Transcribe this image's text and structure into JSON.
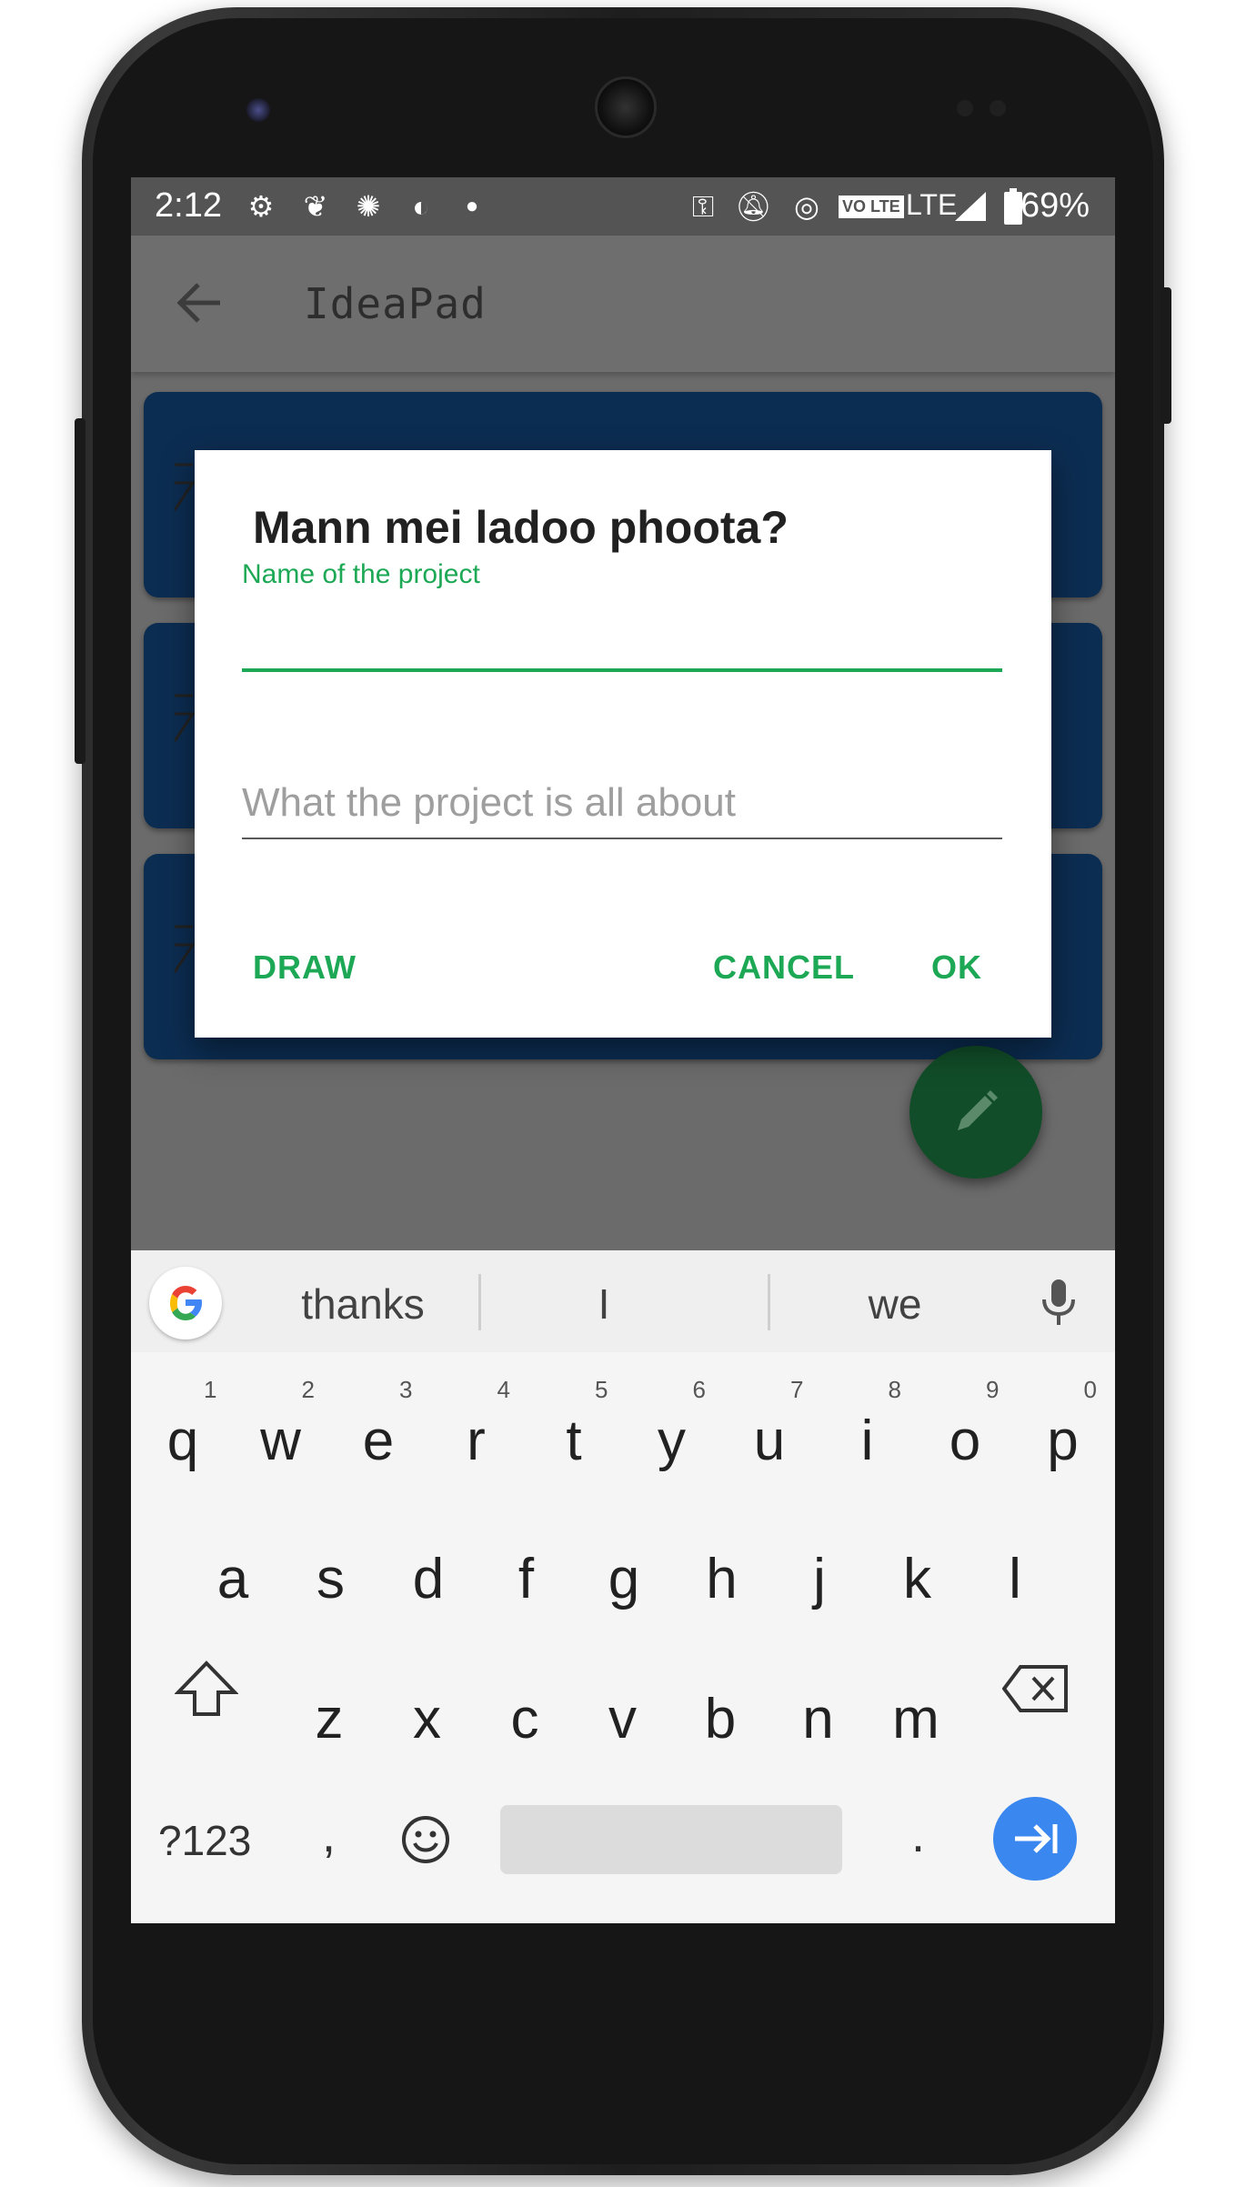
{
  "status_bar": {
    "time": "2:12",
    "network": "LTE",
    "volte": "VO LTE",
    "battery": "69%"
  },
  "app_bar": {
    "title": "IdeaPad",
    "back_icon": "arrow-back-icon"
  },
  "dialog": {
    "title": "Mann mei ladoo phoota?",
    "name_label": "Name of the project",
    "name_value": "",
    "description_placeholder": "What the project is all about",
    "draw_label": "DRAW",
    "cancel_label": "CANCEL",
    "ok_label": "OK"
  },
  "fab": {
    "icon": "pencil-icon"
  },
  "keyboard": {
    "suggestions": [
      "thanks",
      "I",
      "we"
    ],
    "row1": [
      "q",
      "w",
      "e",
      "r",
      "t",
      "y",
      "u",
      "i",
      "o",
      "p"
    ],
    "row1_hints": [
      "1",
      "2",
      "3",
      "4",
      "5",
      "6",
      "7",
      "8",
      "9",
      "0"
    ],
    "row2": [
      "a",
      "s",
      "d",
      "f",
      "g",
      "h",
      "j",
      "k",
      "l"
    ],
    "row3": [
      "z",
      "x",
      "c",
      "v",
      "b",
      "n",
      "m"
    ],
    "symbols_label": "?123",
    "comma": ",",
    "period": "."
  },
  "colors": {
    "accent_green": "#1da855",
    "card_blue": "#0c2d52",
    "fab_green": "#114d28",
    "enter_blue": "#3b87f0"
  }
}
